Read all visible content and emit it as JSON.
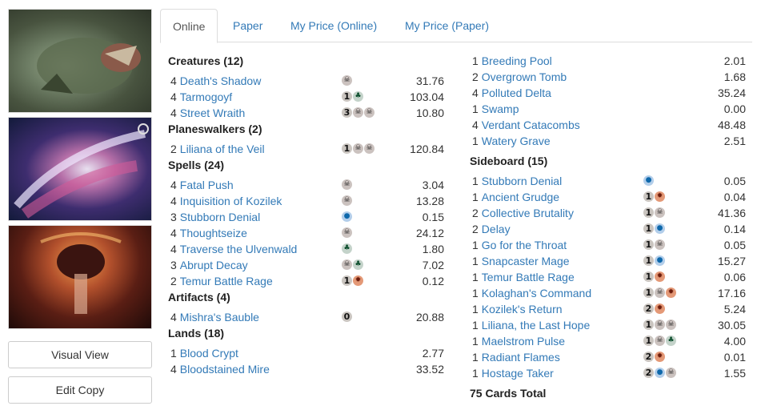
{
  "tabs": [
    {
      "label": "Online"
    },
    {
      "label": "Paper"
    },
    {
      "label": "My Price (Online)"
    },
    {
      "label": "My Price (Paper)"
    }
  ],
  "buttons": {
    "visual_view": "Visual View",
    "edit_copy": "Edit Copy"
  },
  "colors": {
    "link": "#337ab7",
    "black_mana": "#cbc2bf",
    "green_mana": "#c4d3ca",
    "blue_mana": "#b3ceea",
    "red_mana": "#e49977"
  },
  "sections": [
    {
      "header": "Creatures (12)",
      "cards": [
        {
          "qty": "4",
          "name": "Death's Shadow",
          "cost": [
            "B"
          ],
          "price": "31.76"
        },
        {
          "qty": "4",
          "name": "Tarmogoyf",
          "cost": [
            "1",
            "G"
          ],
          "price": "103.04"
        },
        {
          "qty": "4",
          "name": "Street Wraith",
          "cost": [
            "3",
            "B",
            "B"
          ],
          "price": "10.80"
        }
      ]
    },
    {
      "header": "Planeswalkers (2)",
      "cards": [
        {
          "qty": "2",
          "name": "Liliana of the Veil",
          "cost": [
            "1",
            "B",
            "B"
          ],
          "price": "120.84"
        }
      ]
    },
    {
      "header": "Spells (24)",
      "cards": [
        {
          "qty": "4",
          "name": "Fatal Push",
          "cost": [
            "B"
          ],
          "price": "3.04"
        },
        {
          "qty": "4",
          "name": "Inquisition of Kozilek",
          "cost": [
            "B"
          ],
          "price": "13.28"
        },
        {
          "qty": "3",
          "name": "Stubborn Denial",
          "cost": [
            "U"
          ],
          "price": "0.15"
        },
        {
          "qty": "4",
          "name": "Thoughtseize",
          "cost": [
            "B"
          ],
          "price": "24.12"
        },
        {
          "qty": "4",
          "name": "Traverse the Ulvenwald",
          "cost": [
            "G"
          ],
          "price": "1.80"
        },
        {
          "qty": "3",
          "name": "Abrupt Decay",
          "cost": [
            "B",
            "G"
          ],
          "price": "7.02"
        },
        {
          "qty": "2",
          "name": "Temur Battle Rage",
          "cost": [
            "1",
            "R"
          ],
          "price": "0.12"
        }
      ]
    },
    {
      "header": "Artifacts (4)",
      "cards": [
        {
          "qty": "4",
          "name": "Mishra's Bauble",
          "cost": [
            "0"
          ],
          "price": "20.88"
        }
      ]
    },
    {
      "header": "Lands (18)",
      "cards": [
        {
          "qty": "1",
          "name": "Blood Crypt",
          "cost": [],
          "price": "2.77"
        },
        {
          "qty": "4",
          "name": "Bloodstained Mire",
          "cost": [],
          "price": "33.52"
        }
      ]
    }
  ],
  "lands_cont": [
    {
      "qty": "1",
      "name": "Breeding Pool",
      "price": "2.01"
    },
    {
      "qty": "2",
      "name": "Overgrown Tomb",
      "price": "1.68"
    },
    {
      "qty": "4",
      "name": "Polluted Delta",
      "price": "35.24"
    },
    {
      "qty": "1",
      "name": "Swamp",
      "price": "0.00"
    },
    {
      "qty": "4",
      "name": "Verdant Catacombs",
      "price": "48.48"
    },
    {
      "qty": "1",
      "name": "Watery Grave",
      "price": "2.51"
    }
  ],
  "sideboard": {
    "header": "Sideboard (15)",
    "cards": [
      {
        "qty": "1",
        "name": "Stubborn Denial",
        "cost": [
          "U"
        ],
        "price": "0.05"
      },
      {
        "qty": "1",
        "name": "Ancient Grudge",
        "cost": [
          "1",
          "R"
        ],
        "price": "0.04"
      },
      {
        "qty": "2",
        "name": "Collective Brutality",
        "cost": [
          "1",
          "B"
        ],
        "price": "41.36"
      },
      {
        "qty": "2",
        "name": "Delay",
        "cost": [
          "1",
          "U"
        ],
        "price": "0.14"
      },
      {
        "qty": "1",
        "name": "Go for the Throat",
        "cost": [
          "1",
          "B"
        ],
        "price": "0.05"
      },
      {
        "qty": "1",
        "name": "Snapcaster Mage",
        "cost": [
          "1",
          "U"
        ],
        "price": "15.27"
      },
      {
        "qty": "1",
        "name": "Temur Battle Rage",
        "cost": [
          "1",
          "R"
        ],
        "price": "0.06"
      },
      {
        "qty": "1",
        "name": "Kolaghan's Command",
        "cost": [
          "1",
          "B",
          "R"
        ],
        "price": "17.16"
      },
      {
        "qty": "1",
        "name": "Kozilek's Return",
        "cost": [
          "2",
          "R"
        ],
        "price": "5.24"
      },
      {
        "qty": "1",
        "name": "Liliana, the Last Hope",
        "cost": [
          "1",
          "B",
          "B"
        ],
        "price": "30.05"
      },
      {
        "qty": "1",
        "name": "Maelstrom Pulse",
        "cost": [
          "1",
          "B",
          "G"
        ],
        "price": "4.00"
      },
      {
        "qty": "1",
        "name": "Radiant Flames",
        "cost": [
          "2",
          "R"
        ],
        "price": "0.01"
      },
      {
        "qty": "1",
        "name": "Hostage Taker",
        "cost": [
          "2",
          "U",
          "B"
        ],
        "price": "1.55"
      }
    ]
  },
  "total": "75 Cards Total"
}
